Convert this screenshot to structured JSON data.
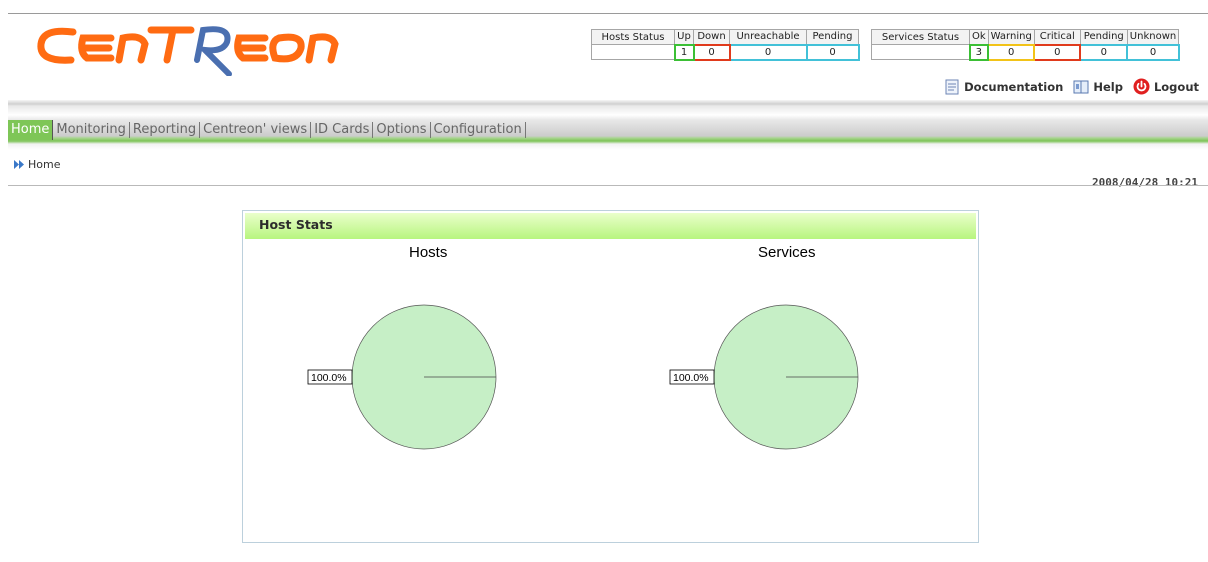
{
  "logo": {
    "text": "CENTREON",
    "color": "#ff6b12"
  },
  "hosts_status": {
    "headers": [
      "Hosts Status",
      "Up",
      "Down",
      "Unreachable",
      "Pending"
    ],
    "values": {
      "up": "1",
      "down": "0",
      "unreachable": "0",
      "pending": "0"
    }
  },
  "services_status": {
    "headers": [
      "Services Status",
      "Ok",
      "Warning",
      "Critical",
      "Pending",
      "Unknown"
    ],
    "values": {
      "ok": "3",
      "warning": "0",
      "critical": "0",
      "pending": "0",
      "unknown": "0"
    }
  },
  "toplinks": {
    "documentation": "Documentation",
    "help": "Help",
    "logout": "Logout"
  },
  "menu": {
    "items": [
      "Home",
      "Monitoring",
      "Reporting",
      "Centreon' views",
      "ID Cards",
      "Options",
      "Configuration"
    ]
  },
  "breadcrumb": {
    "label": "Home"
  },
  "datetime": "2008/04/28 10:21",
  "panel": {
    "title": "Host Stats"
  },
  "colors": {
    "up_green": "#3bbf35",
    "down_red": "#e03a1c",
    "pending_cyan": "#42c1d8",
    "warning_yellow": "#f2c318",
    "pie_fill": "#c6efc6"
  },
  "chart_data": [
    {
      "type": "pie",
      "title": "Hosts",
      "slices": [
        {
          "label": "100.0%",
          "value": 100
        }
      ]
    },
    {
      "type": "pie",
      "title": "Services",
      "slices": [
        {
          "label": "100.0%",
          "value": 100
        }
      ]
    }
  ]
}
